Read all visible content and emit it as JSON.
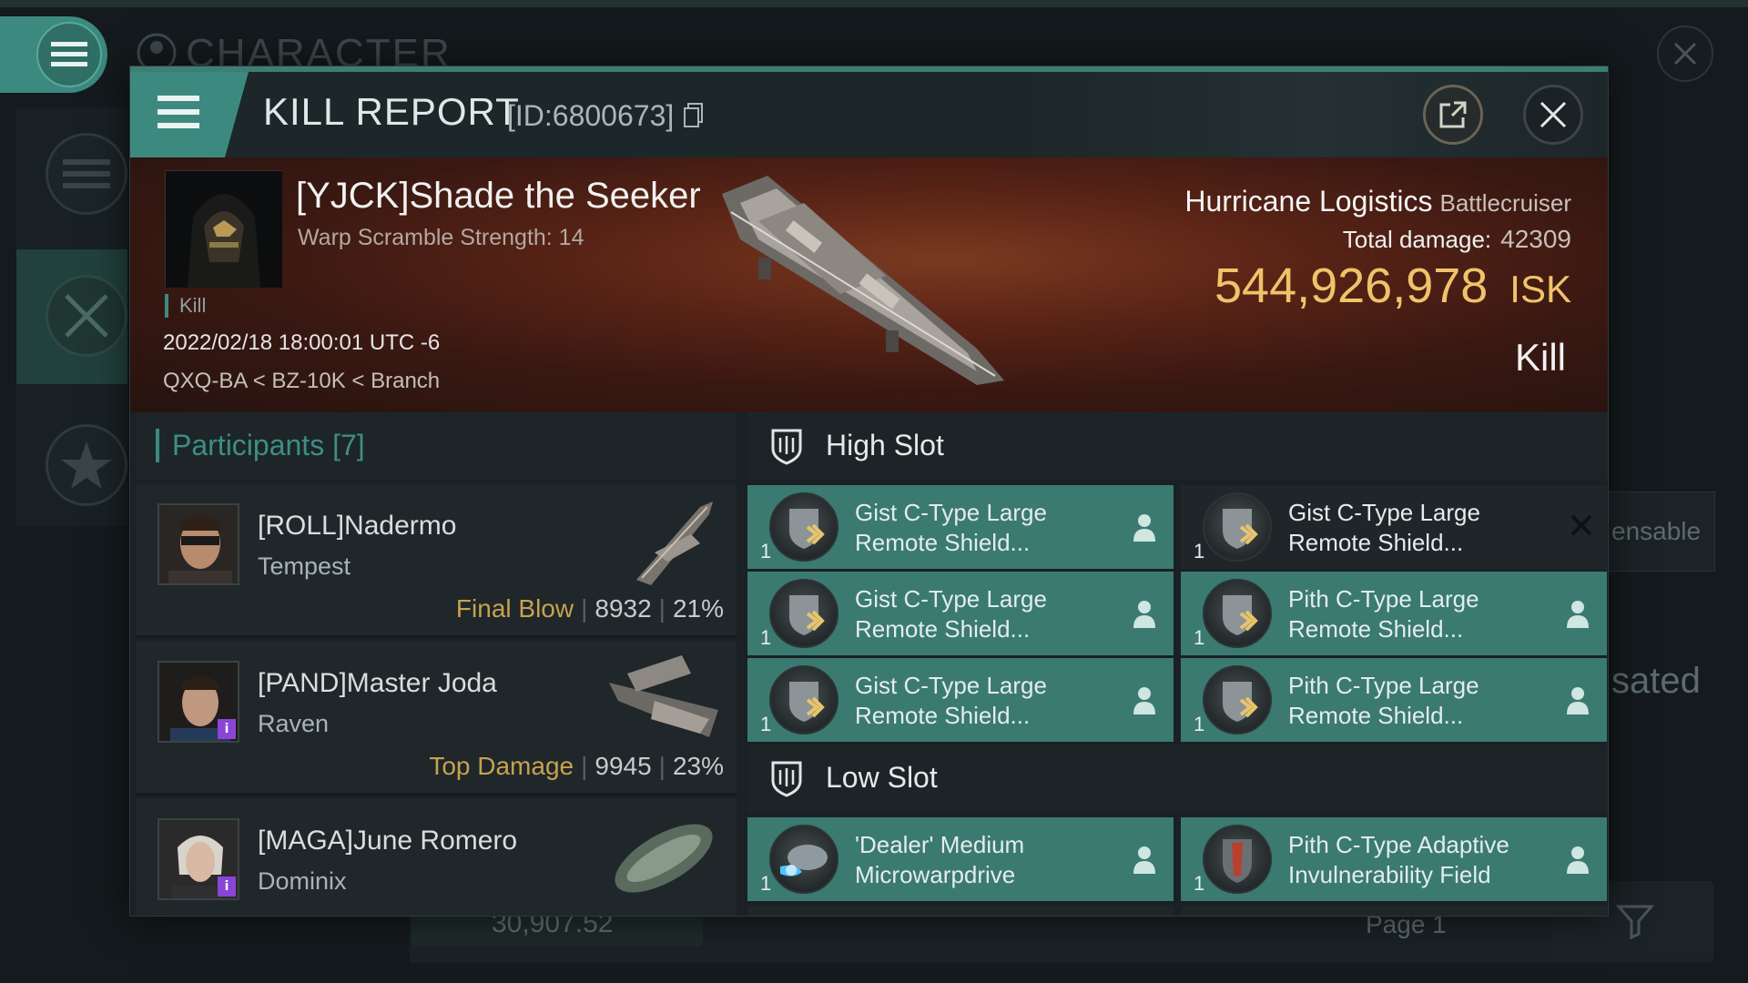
{
  "background": {
    "title": "CHARACTER",
    "right_text_1": "ensable",
    "right_text_2": "sated",
    "bottom_value": "30,907.52",
    "page_label": "Page 1"
  },
  "header": {
    "title": "KILL REPORT",
    "report_id": "[ID:6800673]"
  },
  "victim": {
    "name": "[YJCK]Shade the Seeker",
    "warp_scramble": "Warp Scramble Strength: 14",
    "kill_tag": "Kill",
    "datetime": "2022/02/18 18:00:01 UTC -6",
    "location": "QXQ-BA < BZ-10K < Branch",
    "ship_name": "Hurricane Logistics",
    "ship_class": "Battlecruiser",
    "total_damage_label": "Total damage:",
    "total_damage": "42309",
    "isk_value": "544,926,978",
    "isk_unit": "ISK",
    "result": "Kill"
  },
  "participants": {
    "title": "Participants [7]",
    "rows": [
      {
        "name": "[ROLL]Nadermo",
        "ship": "Tempest",
        "role": "Final Blow",
        "damage": "8932",
        "percent": "21%"
      },
      {
        "name": "[PAND]Master Joda",
        "ship": "Raven",
        "role": "Top Damage",
        "damage": "9945",
        "percent": "23%"
      },
      {
        "name": "[MAGA]June Romero",
        "ship": "Dominix",
        "role": "",
        "damage": "",
        "percent": ""
      }
    ]
  },
  "high_slot": {
    "title": "High Slot",
    "modules": [
      {
        "name_line1": "Gist C-Type Large",
        "name_line2": "Remote Shield...",
        "qty": "1",
        "state": "dropped"
      },
      {
        "name_line1": "Gist C-Type Large",
        "name_line2": "Remote Shield...",
        "qty": "1",
        "state": "destroyed"
      },
      {
        "name_line1": "Gist C-Type Large",
        "name_line2": "Remote Shield...",
        "qty": "1",
        "state": "dropped"
      },
      {
        "name_line1": "Pith C-Type Large",
        "name_line2": "Remote Shield...",
        "qty": "1",
        "state": "dropped"
      },
      {
        "name_line1": "Gist C-Type Large",
        "name_line2": "Remote Shield...",
        "qty": "1",
        "state": "dropped"
      },
      {
        "name_line1": "Pith C-Type Large",
        "name_line2": "Remote Shield...",
        "qty": "1",
        "state": "dropped"
      }
    ]
  },
  "low_slot": {
    "title": "Low Slot",
    "modules": [
      {
        "name_line1": "'Dealer' Medium",
        "name_line2": "Microwarpdrive",
        "qty": "1",
        "state": "dropped"
      },
      {
        "name_line1": "Pith C-Type Adaptive",
        "name_line2": "Invulnerability Field",
        "qty": "1",
        "state": "dropped"
      }
    ]
  },
  "colors": {
    "accent": "#3c8a7f",
    "isk": "#f0c36a",
    "role": "#c8a24e",
    "dropped_bg": "#3a7a71",
    "destroyed_bg": "#1e2629"
  }
}
